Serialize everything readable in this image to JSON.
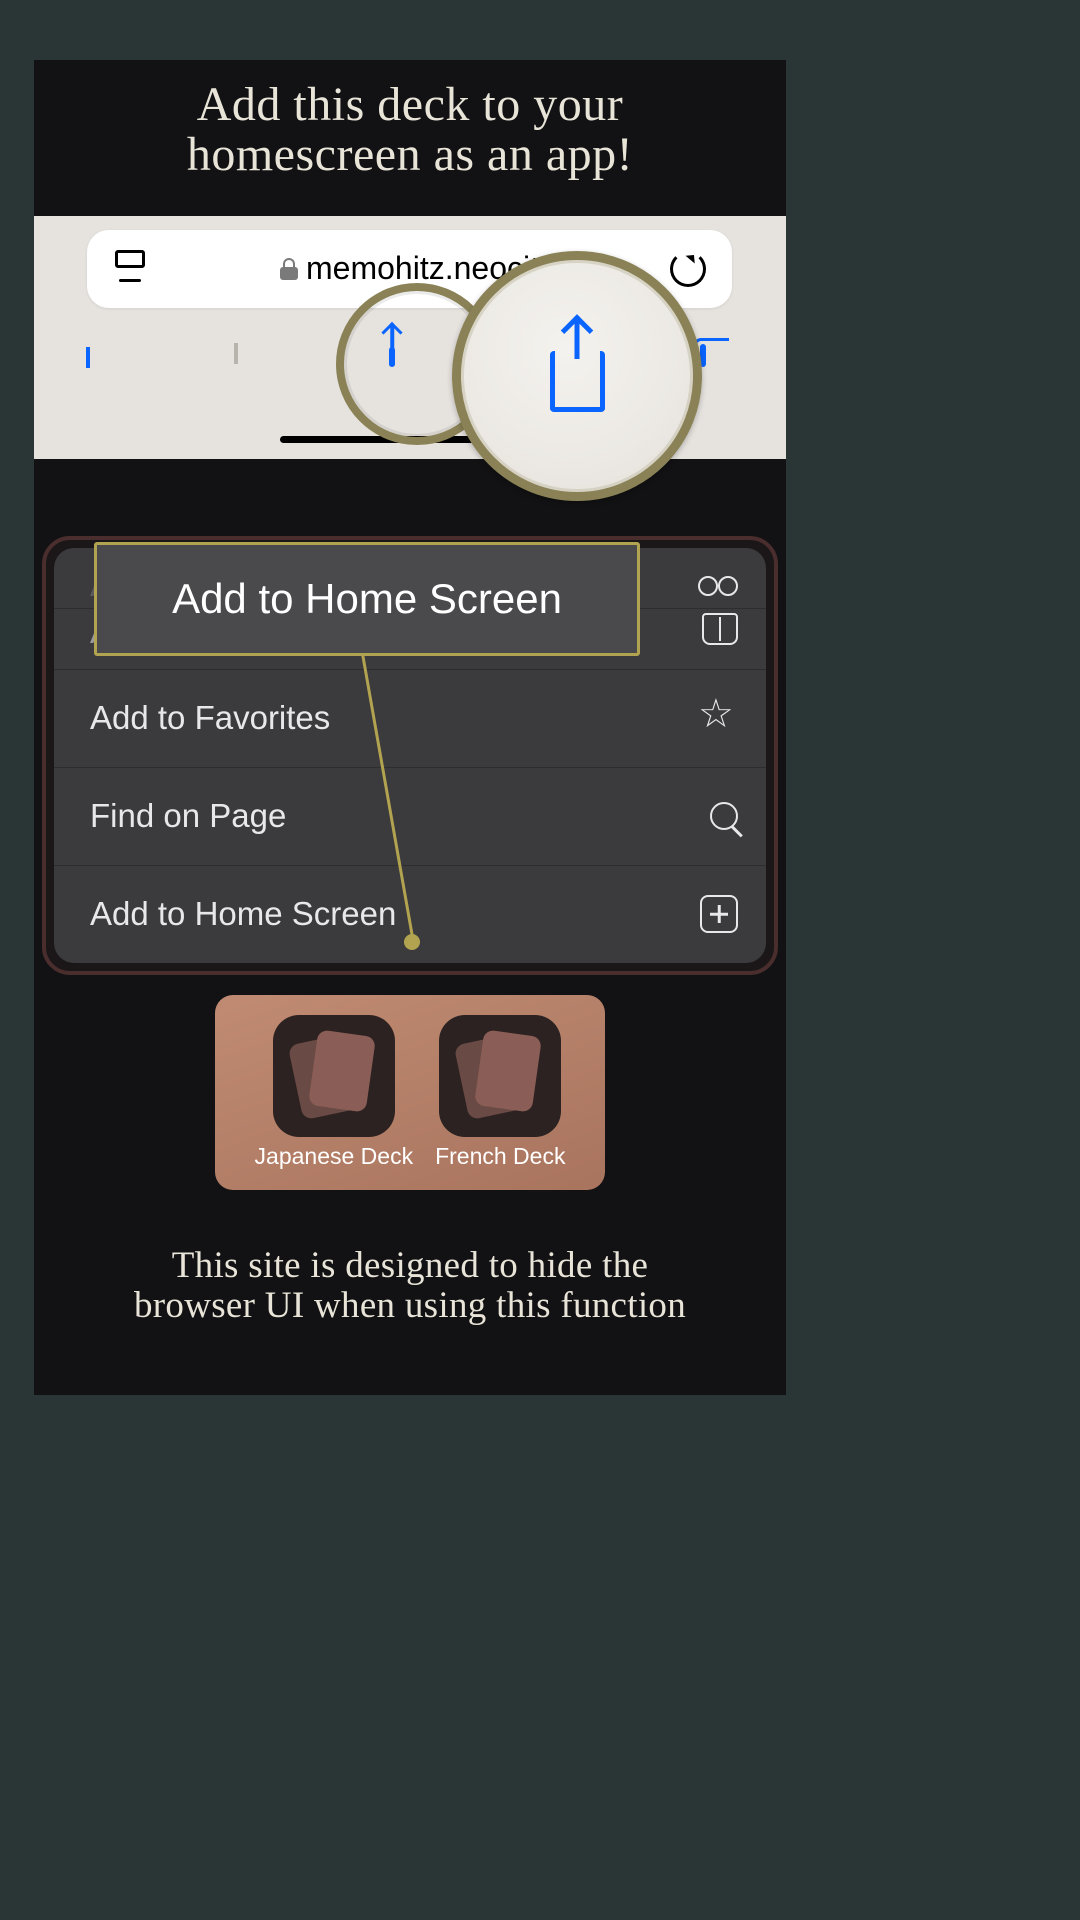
{
  "headline_line1": "Add this deck to your",
  "headline_line2": "homescreen as an app!",
  "safari": {
    "url_text": "memohitz.neocit"
  },
  "callout": "Add to Home Screen",
  "sheet": {
    "row_readinglist_partial": "Add to Reading List",
    "row_bookmark_partial": "Add Bookmark",
    "row_favorites": "Add to Favorites",
    "row_find": "Find on Page",
    "row_homescreen": "Add to Home Screen"
  },
  "apps": {
    "left": "Japanese Deck",
    "right": "French Deck"
  },
  "footer_line1": "This site is designed to hide the",
  "footer_line2": "browser UI when using this function"
}
